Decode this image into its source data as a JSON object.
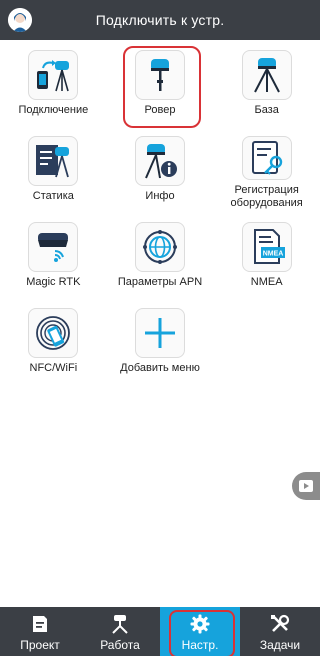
{
  "header": {
    "title": "Подключить к устр."
  },
  "tiles": [
    {
      "label": "Подключение",
      "icon": "connection-icon"
    },
    {
      "label": "Ровер",
      "icon": "rover-icon"
    },
    {
      "label": "База",
      "icon": "base-icon"
    },
    {
      "label": "Статика",
      "icon": "static-icon"
    },
    {
      "label": "Инфо",
      "icon": "info-icon"
    },
    {
      "label": "Регистрация оборудования",
      "icon": "registration-icon"
    },
    {
      "label": "Magic RTK",
      "icon": "magic-rtk-icon"
    },
    {
      "label": "Параметры APN",
      "icon": "apn-icon"
    },
    {
      "label": "NMEA",
      "icon": "nmea-icon"
    },
    {
      "label": "NFC/WiFi",
      "icon": "nfc-wifi-icon"
    },
    {
      "label": "Добавить меню",
      "icon": "add-icon"
    }
  ],
  "nmea_badge": "NMEA",
  "bottom_nav": [
    {
      "label": "Проект",
      "icon": "project-icon"
    },
    {
      "label": "Работа",
      "icon": "work-icon"
    },
    {
      "label": "Настр.",
      "icon": "settings-icon",
      "active": true
    },
    {
      "label": "Задачи",
      "icon": "tools-icon"
    }
  ],
  "colors": {
    "header": "#3b3f45",
    "accent": "#16a3dc",
    "highlight": "#d93236"
  }
}
